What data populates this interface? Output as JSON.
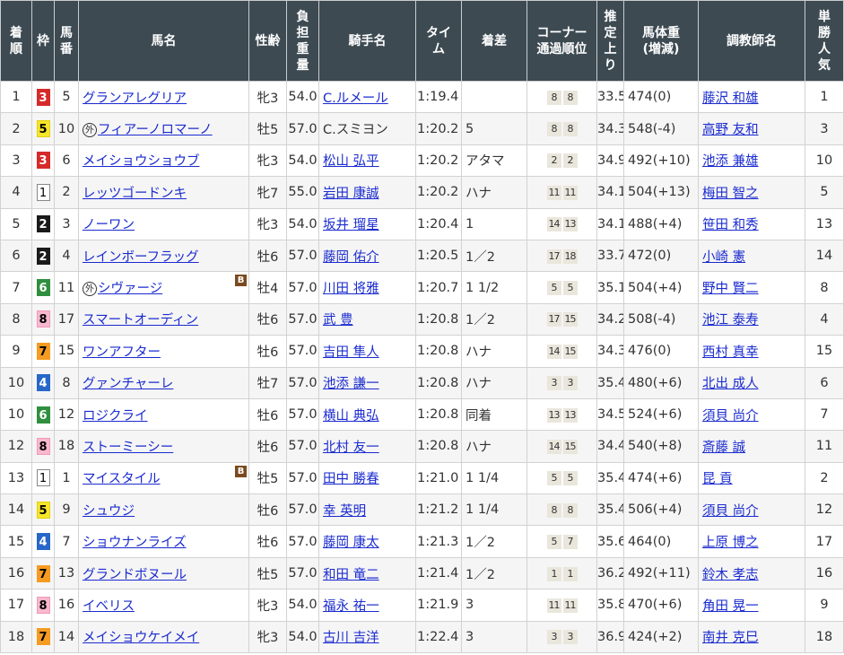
{
  "headers": {
    "rank": "着順",
    "waku": "枠",
    "num": "馬番",
    "name": "馬名",
    "sexage": "性齢",
    "weight": "負担重量",
    "jockey": "騎手名",
    "time": "タイム",
    "margin": "着差",
    "corner_line1": "コーナー",
    "corner_line2": "通過順位",
    "last3f": "推定上り",
    "bodyweight_line1": "馬体重",
    "bodyweight_line2": "(増減)",
    "trainer": "調教師名",
    "popularity": "単勝人気"
  },
  "gaikoku_mark": "外",
  "blinker_mark": "B",
  "rows": [
    {
      "rank": "1",
      "waku": "3",
      "num": "5",
      "gai": false,
      "name": "グランアレグリア",
      "blinker": false,
      "sexage": "牝3",
      "weight": "54.0",
      "jockey": "C.ルメール",
      "jockey_link": true,
      "time": "1:19.4",
      "margin": "",
      "c1": "8",
      "c2": "8",
      "last3f": "33.5",
      "bw": "474",
      "bwd": "(0)",
      "trainer": "藤沢 和雄",
      "pop": "1"
    },
    {
      "rank": "2",
      "waku": "5",
      "num": "10",
      "gai": true,
      "name": "フィアーノロマーノ",
      "blinker": false,
      "sexage": "牡5",
      "weight": "57.0",
      "jockey": "C.スミヨン",
      "jockey_link": false,
      "time": "1:20.2",
      "margin": "5",
      "c1": "8",
      "c2": "8",
      "last3f": "34.3",
      "bw": "548",
      "bwd": "(-4)",
      "trainer": "高野 友和",
      "pop": "3"
    },
    {
      "rank": "3",
      "waku": "3",
      "num": "6",
      "gai": false,
      "name": "メイショウショウブ",
      "blinker": false,
      "sexage": "牝3",
      "weight": "54.0",
      "jockey": "松山 弘平",
      "jockey_link": true,
      "time": "1:20.2",
      "margin": "アタマ",
      "c1": "2",
      "c2": "2",
      "last3f": "34.9",
      "bw": "492",
      "bwd": "(+10)",
      "trainer": "池添 兼雄",
      "pop": "10"
    },
    {
      "rank": "4",
      "waku": "1",
      "num": "2",
      "gai": false,
      "name": "レッツゴードンキ",
      "blinker": false,
      "sexage": "牝7",
      "weight": "55.0",
      "jockey": "岩田 康誠",
      "jockey_link": true,
      "time": "1:20.2",
      "margin": "ハナ",
      "c1": "11",
      "c2": "11",
      "last3f": "34.1",
      "bw": "504",
      "bwd": "(+13)",
      "trainer": "梅田 智之",
      "pop": "5"
    },
    {
      "rank": "5",
      "waku": "2",
      "num": "3",
      "gai": false,
      "name": "ノーワン",
      "blinker": false,
      "sexage": "牝3",
      "weight": "54.0",
      "jockey": "坂井 瑠星",
      "jockey_link": true,
      "time": "1:20.4",
      "margin": "1",
      "c1": "14",
      "c2": "13",
      "last3f": "34.1",
      "bw": "488",
      "bwd": "(+4)",
      "trainer": "笹田 和秀",
      "pop": "13"
    },
    {
      "rank": "6",
      "waku": "2",
      "num": "4",
      "gai": false,
      "name": "レインボーフラッグ",
      "blinker": false,
      "sexage": "牡6",
      "weight": "57.0",
      "jockey": "藤岡 佑介",
      "jockey_link": true,
      "time": "1:20.5",
      "margin": "1／2",
      "c1": "17",
      "c2": "18",
      "last3f": "33.7",
      "bw": "472",
      "bwd": "(0)",
      "trainer": "小崎 憲",
      "pop": "14"
    },
    {
      "rank": "7",
      "waku": "6",
      "num": "11",
      "gai": true,
      "name": "シヴァージ",
      "blinker": true,
      "sexage": "牡4",
      "weight": "57.0",
      "jockey": "川田 将雅",
      "jockey_link": true,
      "time": "1:20.7",
      "margin": "1 1/2",
      "c1": "5",
      "c2": "5",
      "last3f": "35.1",
      "bw": "504",
      "bwd": "(+4)",
      "trainer": "野中 賢二",
      "pop": "8"
    },
    {
      "rank": "8",
      "waku": "8",
      "num": "17",
      "gai": false,
      "name": "スマートオーディン",
      "blinker": false,
      "sexage": "牡6",
      "weight": "57.0",
      "jockey": "武 豊",
      "jockey_link": true,
      "time": "1:20.8",
      "margin": "1／2",
      "c1": "17",
      "c2": "15",
      "last3f": "34.2",
      "bw": "508",
      "bwd": "(-4)",
      "trainer": "池江 泰寿",
      "pop": "4"
    },
    {
      "rank": "9",
      "waku": "7",
      "num": "15",
      "gai": false,
      "name": "ワンアフター",
      "blinker": false,
      "sexage": "牡6",
      "weight": "57.0",
      "jockey": "吉田 隼人",
      "jockey_link": true,
      "time": "1:20.8",
      "margin": "ハナ",
      "c1": "14",
      "c2": "15",
      "last3f": "34.3",
      "bw": "476",
      "bwd": "(0)",
      "trainer": "西村 真幸",
      "pop": "15"
    },
    {
      "rank": "10",
      "waku": "4",
      "num": "8",
      "gai": false,
      "name": "グァンチャーレ",
      "blinker": false,
      "sexage": "牡7",
      "weight": "57.0",
      "jockey": "池添 謙一",
      "jockey_link": true,
      "time": "1:20.8",
      "margin": "ハナ",
      "c1": "3",
      "c2": "3",
      "last3f": "35.4",
      "bw": "480",
      "bwd": "(+6)",
      "trainer": "北出 成人",
      "pop": "6"
    },
    {
      "rank": "10",
      "waku": "6",
      "num": "12",
      "gai": false,
      "name": "ロジクライ",
      "blinker": false,
      "sexage": "牡6",
      "weight": "57.0",
      "jockey": "横山 典弘",
      "jockey_link": true,
      "time": "1:20.8",
      "margin": "同着",
      "c1": "13",
      "c2": "13",
      "last3f": "34.5",
      "bw": "524",
      "bwd": "(+6)",
      "trainer": "須貝 尚介",
      "pop": "7"
    },
    {
      "rank": "12",
      "waku": "8",
      "num": "18",
      "gai": false,
      "name": "ストーミーシー",
      "blinker": false,
      "sexage": "牡6",
      "weight": "57.0",
      "jockey": "北村 友一",
      "jockey_link": true,
      "time": "1:20.8",
      "margin": "ハナ",
      "c1": "14",
      "c2": "15",
      "last3f": "34.4",
      "bw": "540",
      "bwd": "(+8)",
      "trainer": "斎藤 誠",
      "pop": "11"
    },
    {
      "rank": "13",
      "waku": "1",
      "num": "1",
      "gai": false,
      "name": "マイスタイル",
      "blinker": true,
      "sexage": "牡5",
      "weight": "57.0",
      "jockey": "田中 勝春",
      "jockey_link": true,
      "time": "1:21.0",
      "margin": "1 1/4",
      "c1": "5",
      "c2": "5",
      "last3f": "35.4",
      "bw": "474",
      "bwd": "(+6)",
      "trainer": "昆 貢",
      "pop": "2"
    },
    {
      "rank": "14",
      "waku": "5",
      "num": "9",
      "gai": false,
      "name": "シュウジ",
      "blinker": false,
      "sexage": "牡6",
      "weight": "57.0",
      "jockey": "幸 英明",
      "jockey_link": true,
      "time": "1:21.2",
      "margin": "1 1/4",
      "c1": "8",
      "c2": "8",
      "last3f": "35.4",
      "bw": "506",
      "bwd": "(+4)",
      "trainer": "須貝 尚介",
      "pop": "12"
    },
    {
      "rank": "15",
      "waku": "4",
      "num": "7",
      "gai": false,
      "name": "ショウナンライズ",
      "blinker": false,
      "sexage": "牡6",
      "weight": "57.0",
      "jockey": "藤岡 康太",
      "jockey_link": true,
      "time": "1:21.3",
      "margin": "1／2",
      "c1": "5",
      "c2": "7",
      "last3f": "35.6",
      "bw": "464",
      "bwd": "(0)",
      "trainer": "上原 博之",
      "pop": "17"
    },
    {
      "rank": "16",
      "waku": "7",
      "num": "13",
      "gai": false,
      "name": "グランドボヌール",
      "blinker": false,
      "sexage": "牡5",
      "weight": "57.0",
      "jockey": "和田 竜二",
      "jockey_link": true,
      "time": "1:21.4",
      "margin": "1／2",
      "c1": "1",
      "c2": "1",
      "last3f": "36.2",
      "bw": "492",
      "bwd": "(+11)",
      "trainer": "鈴木 孝志",
      "pop": "16"
    },
    {
      "rank": "17",
      "waku": "8",
      "num": "16",
      "gai": false,
      "name": "イベリス",
      "blinker": false,
      "sexage": "牝3",
      "weight": "54.0",
      "jockey": "福永 祐一",
      "jockey_link": true,
      "time": "1:21.9",
      "margin": "3",
      "c1": "11",
      "c2": "11",
      "last3f": "35.8",
      "bw": "470",
      "bwd": "(+6)",
      "trainer": "角田 晃一",
      "pop": "9"
    },
    {
      "rank": "18",
      "waku": "7",
      "num": "14",
      "gai": false,
      "name": "メイショウケイメイ",
      "blinker": false,
      "sexage": "牝3",
      "weight": "54.0",
      "jockey": "古川 吉洋",
      "jockey_link": true,
      "time": "1:22.4",
      "margin": "3",
      "c1": "3",
      "c2": "3",
      "last3f": "36.9",
      "bw": "424",
      "bwd": "(+2)",
      "trainer": "南井 克巳",
      "pop": "18"
    }
  ]
}
